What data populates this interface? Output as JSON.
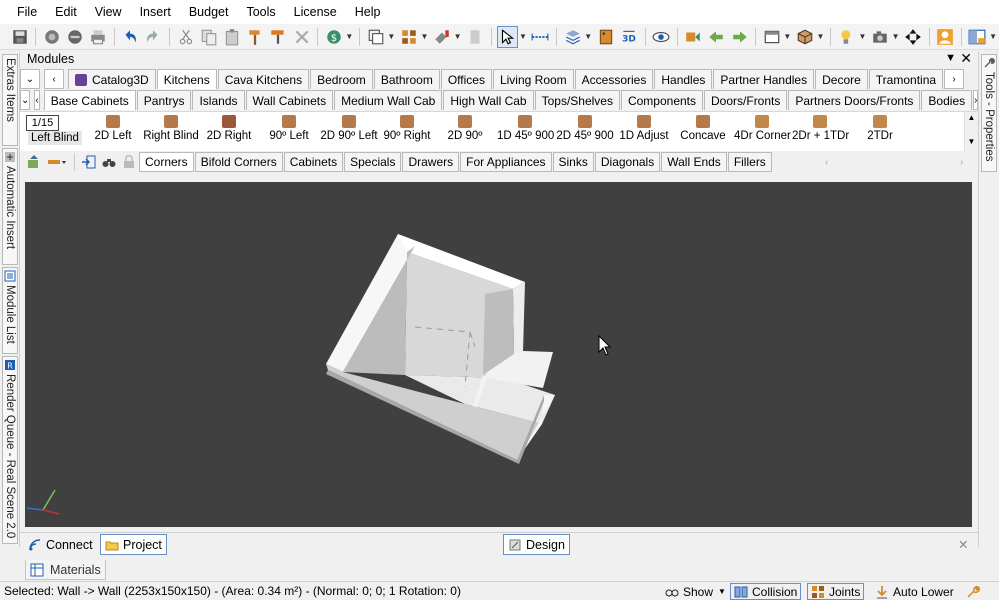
{
  "menu": [
    "File",
    "Edit",
    "View",
    "Insert",
    "Budget",
    "Tools",
    "License",
    "Help"
  ],
  "modules_panel": {
    "title": "Modules",
    "pin_glyph": "📌",
    "close_glyph": "✕",
    "catalog_tabs": [
      "Catalog3D",
      "Kitchens",
      "Cava Kitchens",
      "Bedroom",
      "Bathroom",
      "Offices",
      "Living Room",
      "Accessories",
      "Handles",
      "Partner Handles",
      "Decore",
      "Tramontina"
    ],
    "category_tabs": [
      "Base Cabinets",
      "Pantrys",
      "Islands",
      "Wall Cabinets",
      "Medium Wall Cab",
      "High Wall Cab",
      "Tops/Shelves",
      "Components",
      "Doors/Fronts",
      "Partners Doors/Fronts",
      "Bodies"
    ],
    "pager": "1/15",
    "items": [
      "Left Blind",
      "2D Left",
      "Right Blind",
      "2D Right",
      "90º Left",
      "2D 90º Left",
      "90º Right",
      "2D 90º",
      "1D 45º 900",
      "2D 45º 900",
      "1D Adjust",
      "Concave",
      "4Dr Corner",
      "2Dr + 1TDr",
      "2TDr"
    ],
    "sub_tabs": [
      "Corners",
      "Bifold Corners",
      "Cabinets",
      "Specials",
      "Drawers",
      "For Appliances",
      "Sinks",
      "Diagonals",
      "Wall Ends",
      "Fillers"
    ]
  },
  "left_tabs": [
    "Extras Items",
    "Automatic Insert",
    "Module List",
    "Render Queue - Real Scene 2.0"
  ],
  "right_tabs": [
    "Tools - Properties"
  ],
  "bottom_tabs": {
    "connect": "Connect",
    "project": "Project",
    "design": "Design",
    "close_glyph": "✕"
  },
  "materials_tab": "Materials",
  "status": {
    "selected_text": "Selected: Wall -> Wall (2253x150x150) - (Area: 0.34 m²) - (Normal: 0; 0; 1 Rotation: 0)",
    "show": "Show",
    "collision": "Collision",
    "joints": "Joints",
    "auto_lower": "Auto Lower"
  },
  "colors": {
    "viewport_bg": "#404040",
    "accent_blue": "#1e5fb4",
    "catalog_cube": "#6b3fa0"
  }
}
